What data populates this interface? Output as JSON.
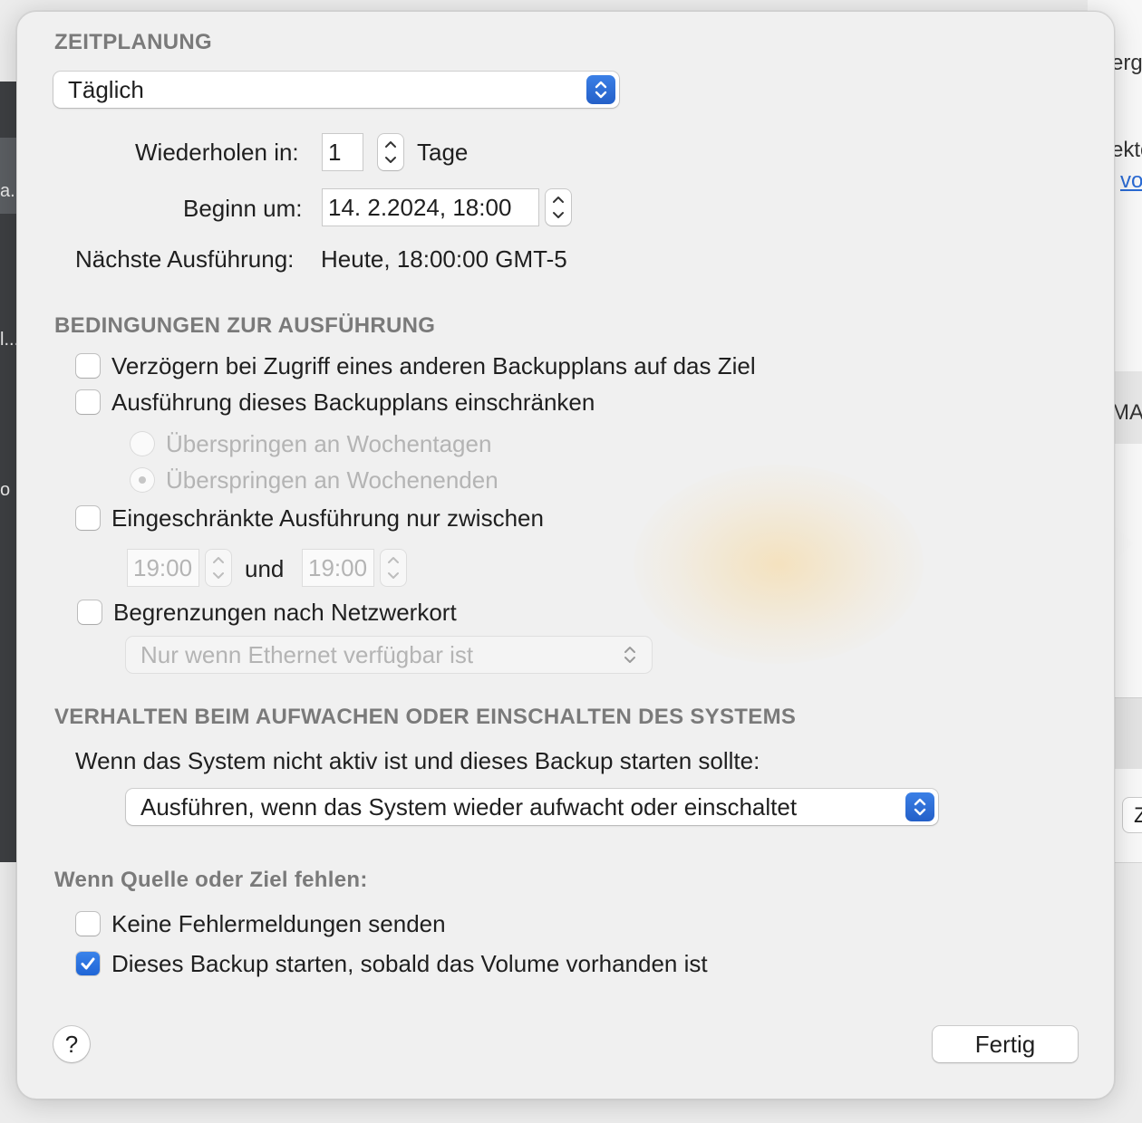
{
  "background": {
    "sidebar_texts": [
      "a...",
      "l...",
      "o"
    ],
    "right_texts": [
      "ergl",
      "ekto",
      "vo",
      "MA",
      "Z"
    ]
  },
  "schedule": {
    "section_title": "ZEITPLANUNG",
    "frequency_value": "Täglich",
    "repeat_label": "Wiederholen in:",
    "repeat_value": "1",
    "repeat_unit": "Tage",
    "start_label": "Beginn um:",
    "start_value": "14.  2.2024, 18:00",
    "next_run_label": "Nächste Ausführung:",
    "next_run_value": "Heute, 18:00:00 GMT-5"
  },
  "conditions": {
    "section_title": "BEDINGUNGEN ZUR AUSFÜHRUNG",
    "delay_label": "Verzögern bei Zugriff eines anderen Backupplans auf das Ziel",
    "delay_checked": false,
    "restrict_label": "Ausführung dieses Backupplans einschränken",
    "restrict_checked": false,
    "skip_weekdays_label": "Überspringen an Wochentagen",
    "skip_weekends_label": "Überspringen an Wochenenden",
    "skip_selected": "weekends",
    "limited_label": "Eingeschränkte Ausführung nur zwischen",
    "limited_checked": false,
    "time_from": "19:00",
    "and_label": "und",
    "time_to": "19:00",
    "network_label": "Begrenzungen nach Netzwerkort",
    "network_checked": false,
    "network_option": "Nur wenn Ethernet verfügbar ist"
  },
  "wake": {
    "section_title": "VERHALTEN BEIM AUFWACHEN ODER EINSCHALTEN DES SYSTEMS",
    "description": "Wenn das System nicht aktiv ist und dieses Backup starten sollte:",
    "option_value": "Ausführen, wenn das System wieder aufwacht oder einschaltet"
  },
  "missing": {
    "section_title": "Wenn Quelle oder Ziel fehlen:",
    "no_errors_label": "Keine Fehlermeldungen senden",
    "no_errors_checked": false,
    "start_when_label": "Dieses Backup starten, sobald das Volume vorhanden ist",
    "start_when_checked": true
  },
  "footer": {
    "help_label": "?",
    "done_label": "Fertig"
  },
  "colors": {
    "accent": "#2a6ad3",
    "section_grey": "#7a7a7a",
    "disabled_text": "#b4b4b4"
  }
}
